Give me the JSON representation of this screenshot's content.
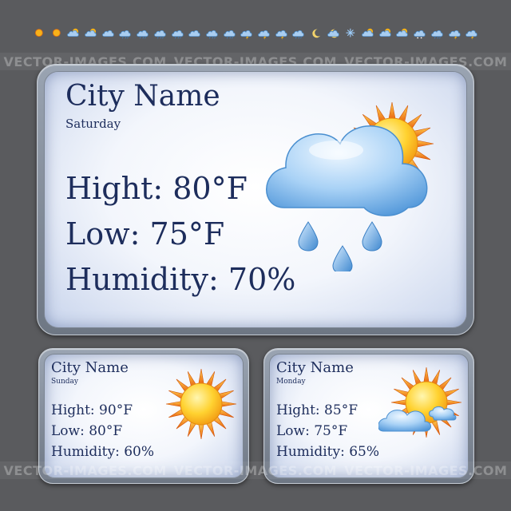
{
  "watermark": "VECTOR-IMAGES.COM",
  "icon_strip": {
    "icons": [
      "sun-icon",
      "sun-icon",
      "sun-cloud-icon",
      "sun-cloud-icon",
      "cloud-icon",
      "cloud-rain-icon",
      "cloud-rain-icon",
      "cloud-rain-icon",
      "cloud-rain-icon",
      "cloud-icon",
      "cloud-rain-icon",
      "cloud-rain-icon",
      "storm-cloud-icon",
      "storm-cloud-icon",
      "storm-cloud-icon",
      "cloud-rain-icon",
      "moon-icon",
      "moon-cloud-icon",
      "snowflake-icon",
      "sun-cloud-icon",
      "sun-cloud-icon",
      "sun-cloud-icon",
      "cloud-snow-icon",
      "cloud-rain-icon",
      "storm-cloud-icon",
      "storm-cloud-icon"
    ]
  },
  "main_card": {
    "city": "City Name",
    "day": "Saturday",
    "high": "Hight: 80°F",
    "low": "Low: 75°F",
    "humidity": "Humidity: 70%",
    "icon": "cloud-sun-rain-icon"
  },
  "small_cards": [
    {
      "city": "City Name",
      "day": "Sunday",
      "high": "Hight: 90°F",
      "low": "Low: 80°F",
      "humidity": "Humidity: 60%",
      "icon": "sun-icon"
    },
    {
      "city": "City Name",
      "day": "Monday",
      "high": "Hight: 85°F",
      "low": "Low: 75°F",
      "humidity": "Humidity: 65%",
      "icon": "sun-cloud-icon"
    }
  ],
  "colors": {
    "background": "#5a5b5e",
    "text": "#1d2d5c",
    "sun": "#f7b21a",
    "sun_ray": "#ea6a12",
    "cloud": "#7fb5e6",
    "rain": "#4a93d6"
  }
}
